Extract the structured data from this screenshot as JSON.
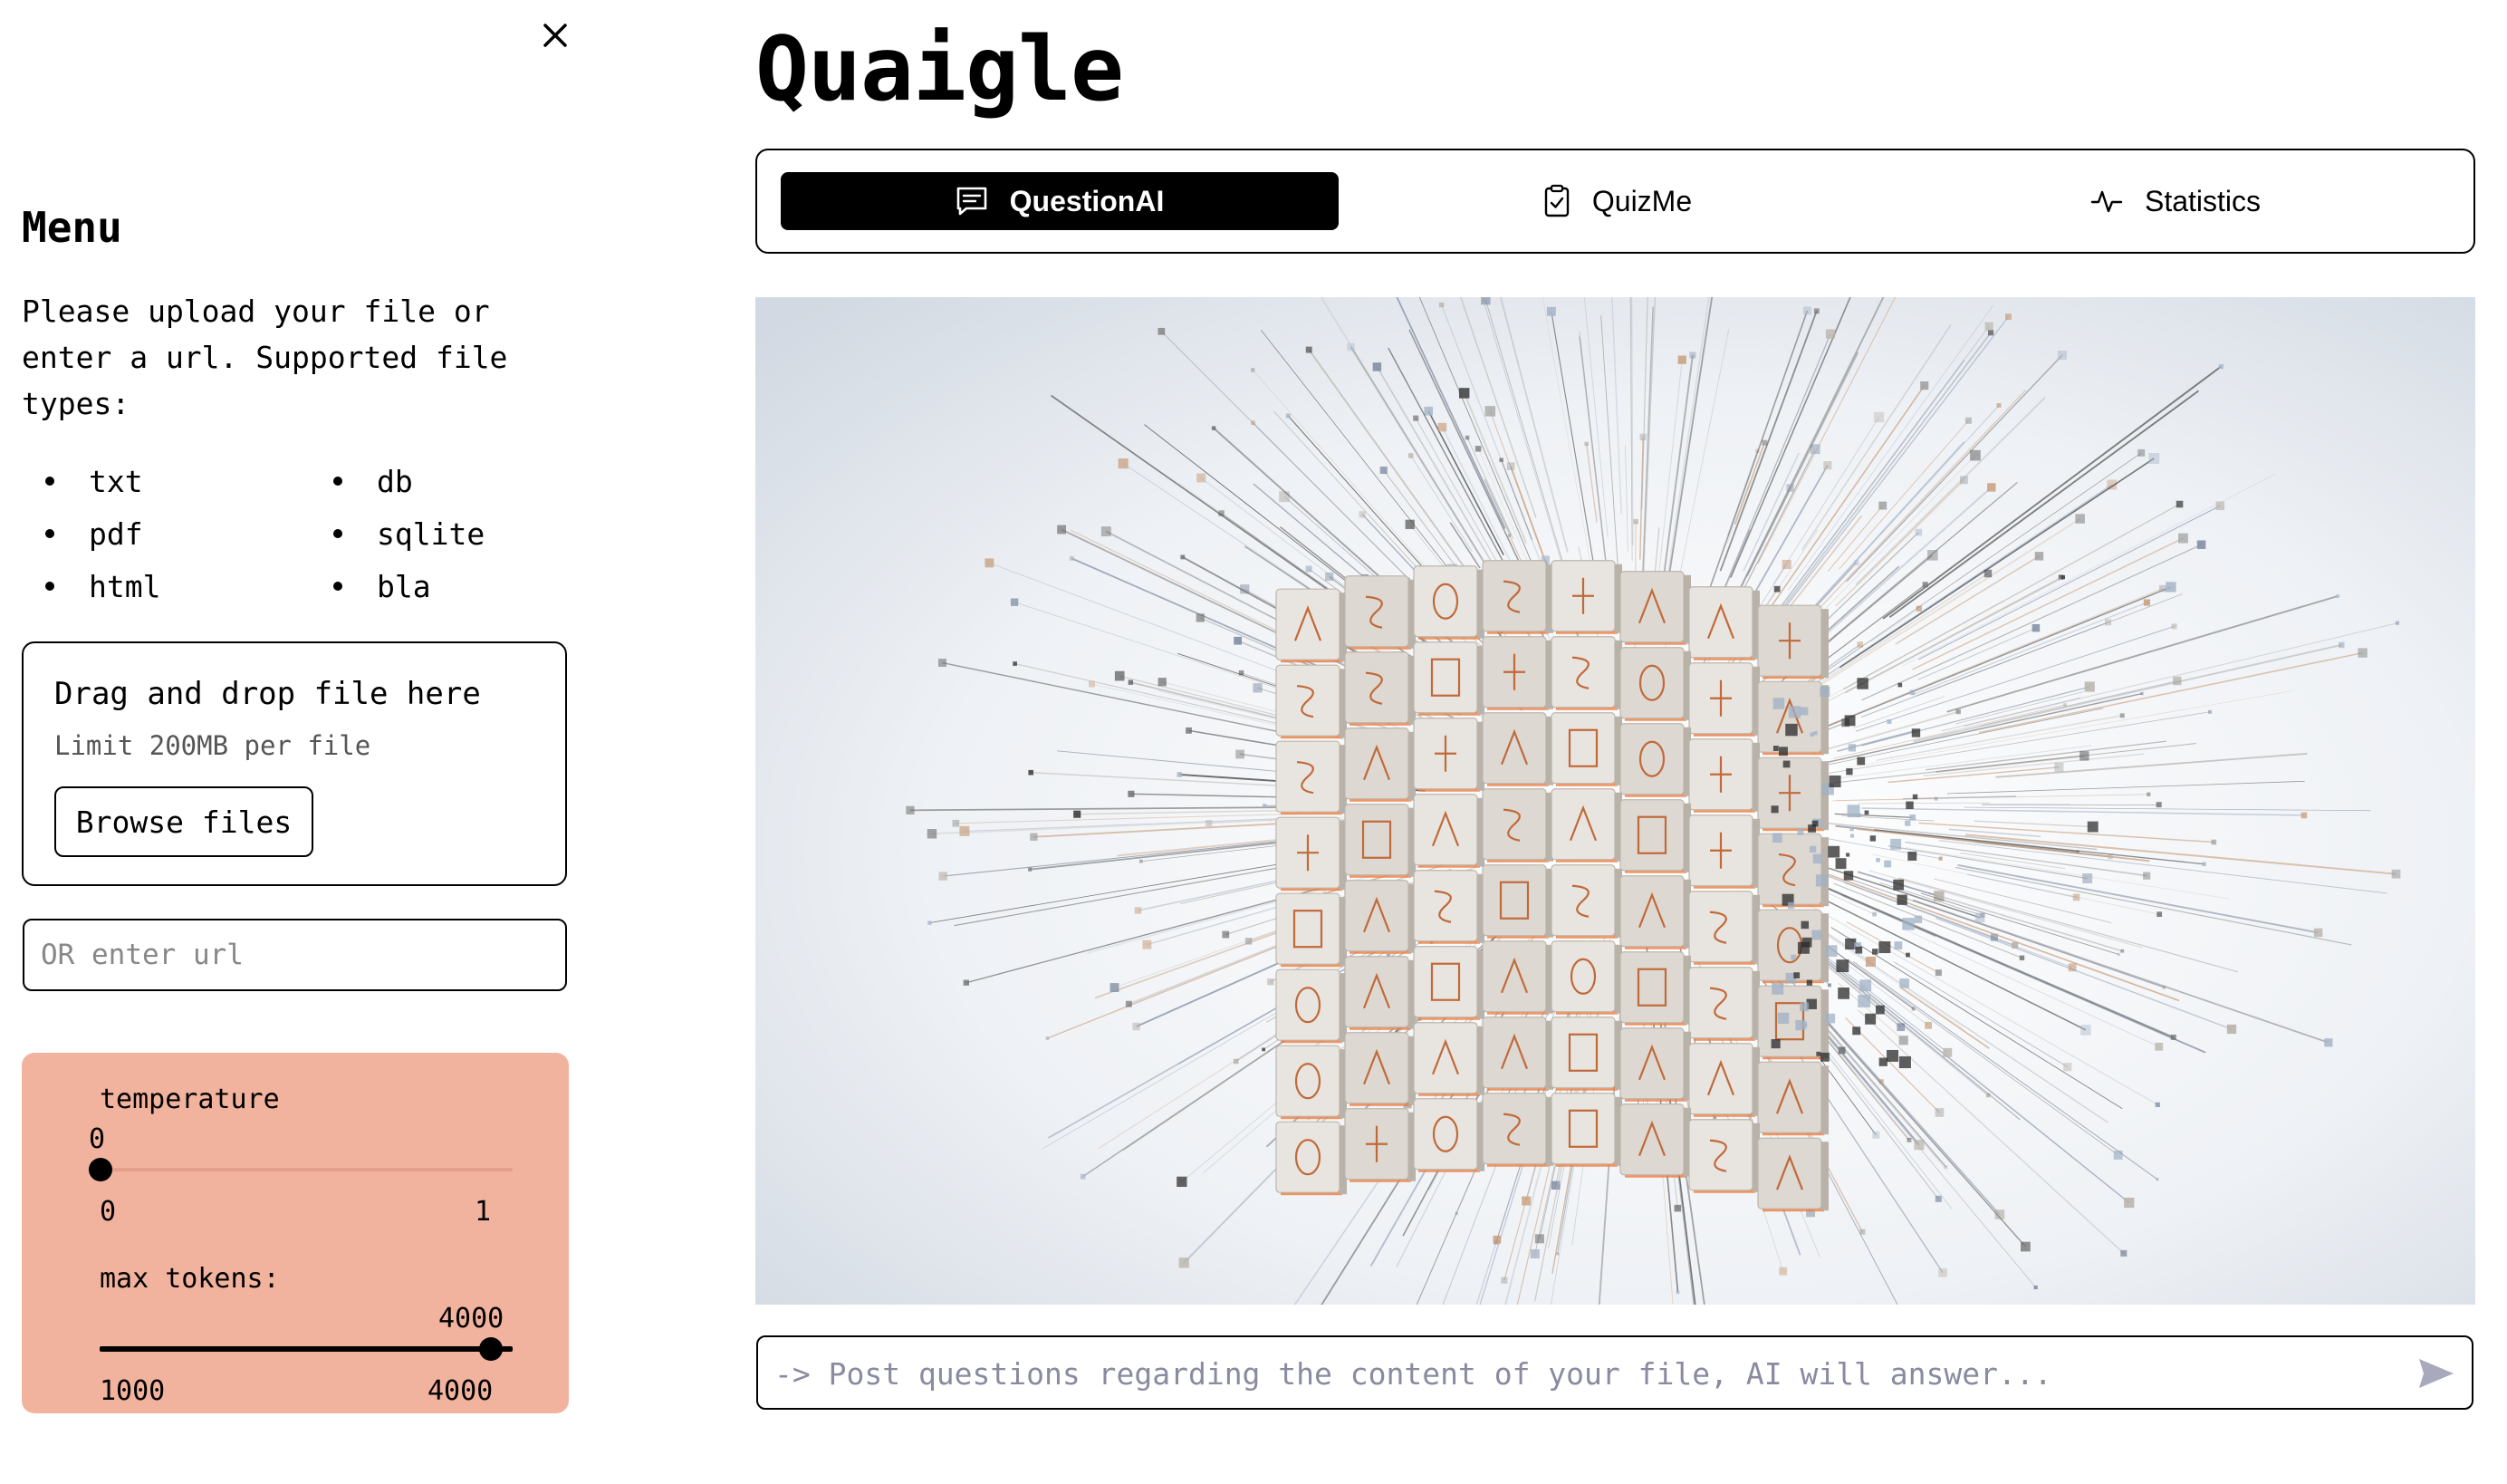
{
  "sidebar": {
    "close_icon": "close-icon",
    "title": "Menu",
    "intro": "Please upload your file or enter a url. Supported file types:",
    "file_types": [
      "txt",
      "db",
      "pdf",
      "sqlite",
      "html",
      "bla"
    ],
    "uploader": {
      "title": "Drag and drop file here",
      "limit": "Limit 200MB per file",
      "browse_label": "Browse files"
    },
    "url_input": {
      "placeholder": "OR enter url",
      "value": ""
    },
    "settings": {
      "background_color": "#f2b39e",
      "temperature": {
        "label": "temperature",
        "value_label": "0",
        "value": 0,
        "min_label": "0",
        "max_label": "1"
      },
      "max_tokens": {
        "label": "max tokens:",
        "value_label": "4000",
        "value": 4000,
        "min_label": "1000",
        "max_label": "4000"
      }
    }
  },
  "app": {
    "title": "Quaigle"
  },
  "tabs": [
    {
      "label": "QuestionAI",
      "icon": "chat-icon",
      "active": true
    },
    {
      "label": "QuizMe",
      "icon": "clipboard-check-icon",
      "active": false
    },
    {
      "label": "Statistics",
      "icon": "activity-icon",
      "active": false
    }
  ],
  "hero_image": {
    "subject": "cube-of-symbol-blocks-illustration"
  },
  "chat": {
    "placeholder": "-> Post questions regarding the content of your file, AI will answer...",
    "value": "",
    "send_icon": "send-icon"
  }
}
